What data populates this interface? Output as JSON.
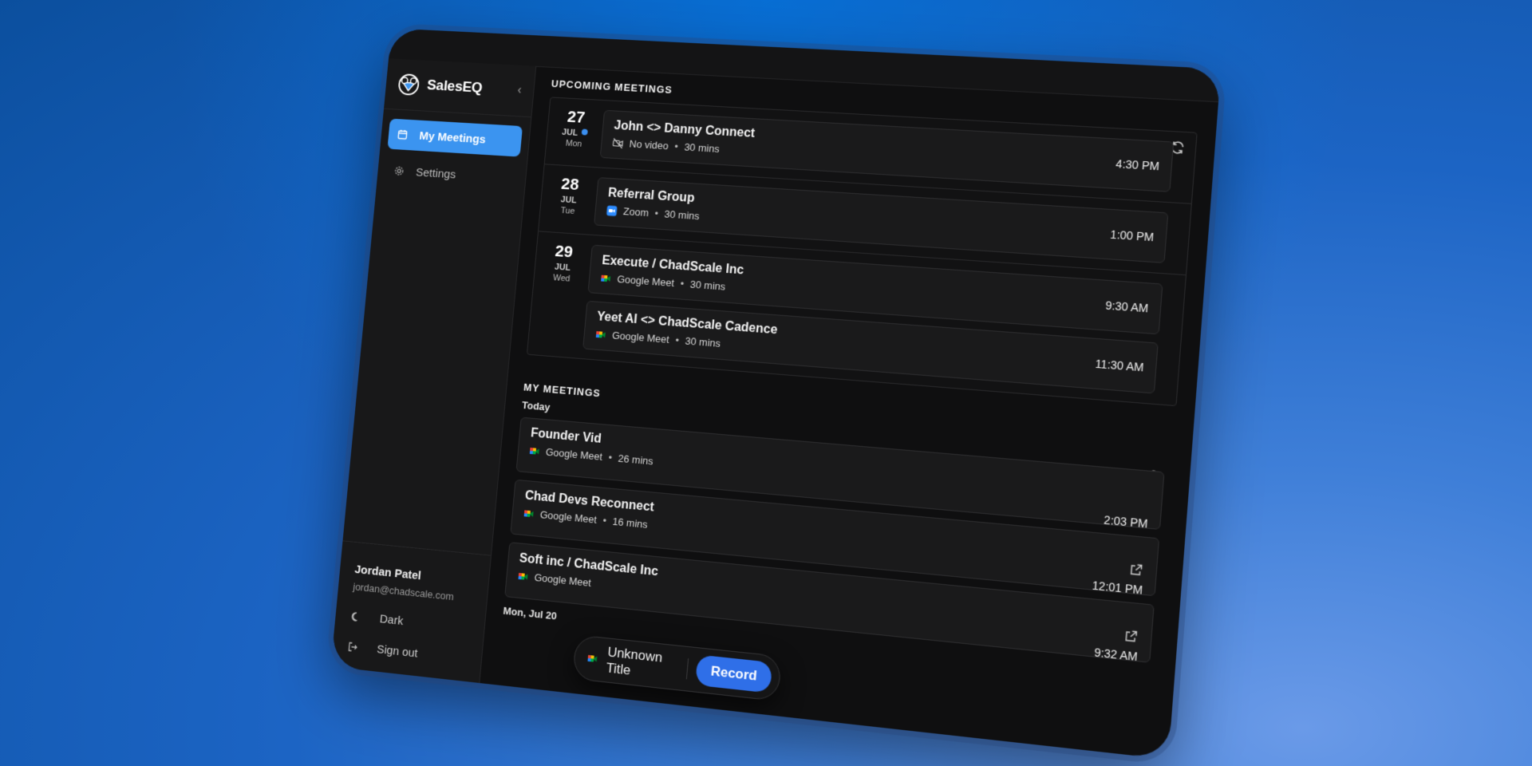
{
  "app": {
    "name": "SalesEQ"
  },
  "sidebar": {
    "items": [
      {
        "label": "My Meetings",
        "icon": "calendar-icon",
        "active": true
      },
      {
        "label": "Settings",
        "icon": "gear-icon",
        "active": false
      }
    ],
    "user": {
      "name": "Jordan Patel",
      "email": "jordan@chadscale.com"
    },
    "theme_label": "Dark",
    "signout_label": "Sign out"
  },
  "upcoming": {
    "title": "UPCOMING MEETINGS",
    "days": [
      {
        "day": "27",
        "month": "JUL",
        "weekday": "Mon",
        "today": true,
        "events": [
          {
            "title": "John <> Danny Connect",
            "platform": "No video",
            "duration": "30 mins",
            "time": "4:30 PM",
            "icon": "no-video-icon"
          }
        ]
      },
      {
        "day": "28",
        "month": "JUL",
        "weekday": "Tue",
        "events": [
          {
            "title": "Referral Group",
            "platform": "Zoom",
            "duration": "30 mins",
            "time": "1:00 PM",
            "icon": "zoom-icon"
          }
        ]
      },
      {
        "day": "29",
        "month": "JUL",
        "weekday": "Wed",
        "events": [
          {
            "title": "Execute / ChadScale Inc",
            "platform": "Google Meet",
            "duration": "30 mins",
            "time": "9:30 AM",
            "icon": "google-meet-icon"
          },
          {
            "title": "Yeet AI <> ChadScale Cadence",
            "platform": "Google Meet",
            "duration": "30 mins",
            "time": "11:30 AM",
            "icon": "google-meet-icon"
          }
        ]
      }
    ]
  },
  "my_meetings": {
    "title": "MY MEETINGS",
    "today_label": "Today",
    "items": [
      {
        "title": "Founder Vid",
        "platform": "Google Meet",
        "duration": "26 mins",
        "time": "2:03 PM"
      },
      {
        "title": "Chad Devs Reconnect",
        "platform": "Google Meet",
        "duration": "16 mins",
        "time": "12:01 PM"
      },
      {
        "title": "Soft inc / ChadScale Inc",
        "platform": "Google Meet",
        "duration": "",
        "time": "9:32 AM"
      }
    ],
    "next_day_label": "Mon, Jul 20"
  },
  "recorder": {
    "title": "Unknown Title",
    "button": "Record"
  },
  "colors": {
    "accent": "#3b94f0",
    "record": "#2f6fe8",
    "background": "#0f0f10"
  }
}
